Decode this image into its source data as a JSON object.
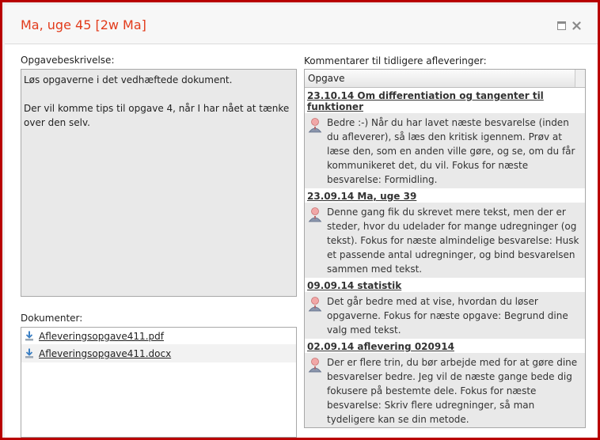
{
  "window": {
    "title": "Ma, uge 45 [2w Ma]",
    "maximize_icon": "maximize-icon",
    "close_icon": "close-icon",
    "title_color": "#e23b1b",
    "border_color": "#b80000"
  },
  "description": {
    "label": "Opgavebeskrivelse:",
    "text": "Løs opgaverne i det vedhæftede dokument.\n\nDer vil komme tips til opgave 4, når I har nået at tænke over den selv."
  },
  "documents": {
    "label": "Dokumenter:",
    "items": [
      {
        "name": "Afleveringsopgave411.pdf",
        "icon": "download-icon"
      },
      {
        "name": "Afleveringsopgave411.docx",
        "icon": "download-icon"
      }
    ]
  },
  "comments": {
    "label": "Kommentarer til tidligere afleveringer:",
    "column_header": "Opgave",
    "entries": [
      {
        "title": "23.10.14 Om differentiation og tangenter til funktioner",
        "text": "Bedre :-) Når du har lavet næste besvarelse (inden du afleverer), så læs den kritisk igennem. Prøv at læse den, som en anden ville gøre, og se, om du får kommunikeret det, du vil. Fokus for næste besvarelse: Formidling."
      },
      {
        "title": "23.09.14 Ma, uge 39",
        "text": "Denne gang fik du skrevet mere tekst, men der er steder, hvor du udelader for mange udregninger (og tekst). Fokus for næste almindelige besvarelse: Husk et passende antal udregninger, og bind besvarelsen sammen med tekst."
      },
      {
        "title": "09.09.14 statistik",
        "text": "Det går bedre med at vise, hvordan du løser opgaverne. Fokus for næste opgave: Begrund dine valg med tekst."
      },
      {
        "title": "02.09.14 aflevering 020914",
        "text": "Der er flere trin, du bør arbejde med for at gøre dine besvarelser bedre. Jeg vil de næste gange bede dig fokusere på bestemte dele. Fokus for næste besvarelse: Skriv flere udregninger, så man tydeligere kan se din metode."
      }
    ]
  }
}
